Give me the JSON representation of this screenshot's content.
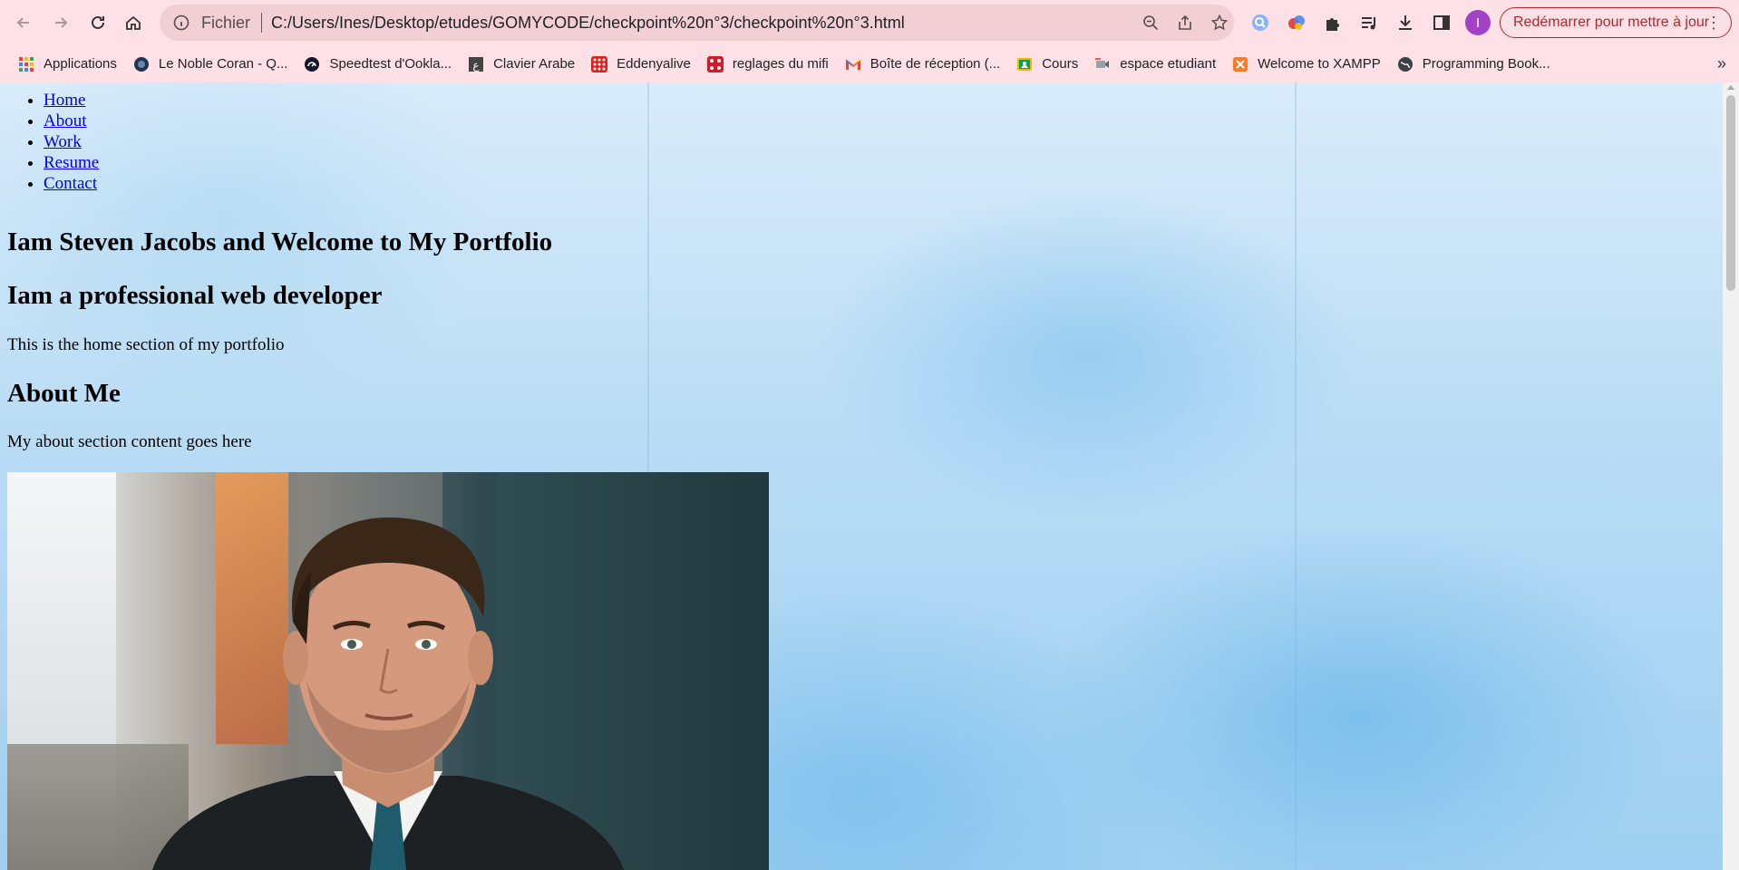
{
  "browser": {
    "omnibox": {
      "scheme_label": "Fichier",
      "url": "C:/Users/Ines/Desktop/etudes/GOMYCODE/checkpoint%20n°3/checkpoint%20n°3.html"
    },
    "profile_initial": "I",
    "update_button_label": "Redémarrer pour mettre à jour",
    "bookmarks": [
      {
        "label": "Applications",
        "icon": "apps-grid-icon"
      },
      {
        "label": "Le Noble Coran - Q...",
        "icon": "quran-site-icon"
      },
      {
        "label": "Speedtest d'Ookla...",
        "icon": "speedtest-icon"
      },
      {
        "label": "Clavier Arabe",
        "icon": "keyboard-site-icon"
      },
      {
        "label": "Eddenyalive",
        "icon": "eddenya-icon"
      },
      {
        "label": "reglages du mifi",
        "icon": "router-icon"
      },
      {
        "label": "Boîte de réception (...",
        "icon": "gmail-icon"
      },
      {
        "label": "Cours",
        "icon": "classroom-icon"
      },
      {
        "label": "espace etudiant",
        "icon": "student-space-icon"
      },
      {
        "label": "Welcome to XAMPP",
        "icon": "xampp-icon"
      },
      {
        "label": "Programming Book...",
        "icon": "globe-icon"
      }
    ],
    "overflow_symbol": "»"
  },
  "page": {
    "nav": [
      "Home",
      "About",
      "Work",
      "Resume",
      "Contact"
    ],
    "heading_welcome": "Iam Steven Jacobs and Welcome to My Portfolio",
    "heading_role": "Iam a professional web developer",
    "home_text": "This is the home section of my portfolio",
    "about_heading": "About Me",
    "about_text": "My about section content goes here",
    "photo_subject": "portrait of a man in a suit"
  },
  "colors": {
    "chrome_bg": "#fde1e6",
    "omnibox_bg": "#f2cfd4",
    "link": "#0000ee",
    "update_accent": "#b3262c",
    "profile": "#a142c9"
  }
}
